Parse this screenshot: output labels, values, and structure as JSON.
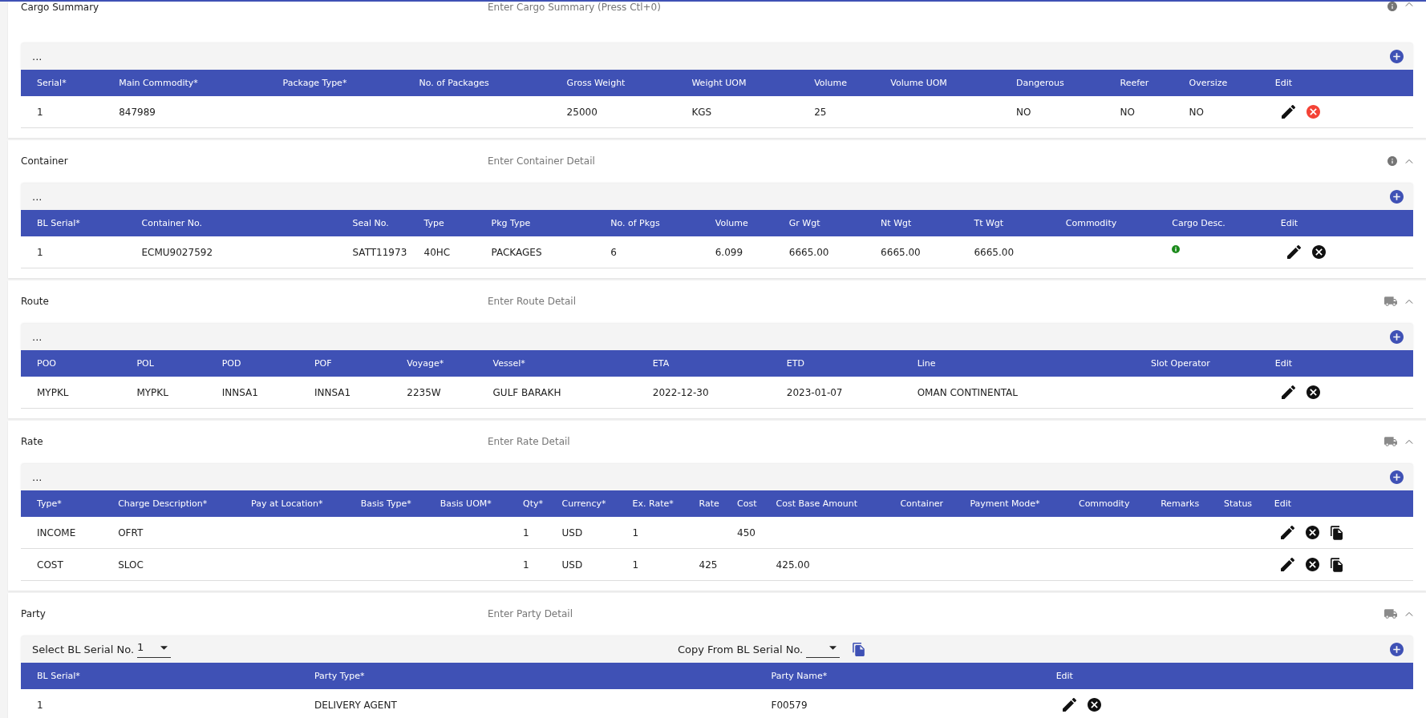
{
  "sections": [
    {
      "title": "Cargo Summary",
      "placeholder": "Enter Cargo Summary (Press Ctl+0)",
      "header_icon": {
        "kind": "info"
      },
      "expanded": true,
      "toolbar": {
        "kind": "menu",
        "text": "..."
      },
      "columns": [
        "Serial*",
        "Main Commodity*",
        "Package Type*",
        "No. of Packages",
        "Gross Weight",
        "Weight UOM",
        "Volume",
        "Volume UOM",
        "Dangerous",
        "Reefer",
        "Oversize",
        "Edit"
      ],
      "rows": [
        {
          "cells": [
            "1",
            "847989",
            null,
            null,
            "25000",
            "KGS",
            "25",
            null,
            "NO",
            "NO",
            "NO"
          ],
          "actions": [
            {
              "kind": "edit"
            },
            {
              "kind": "delete_alert"
            }
          ]
        }
      ]
    },
    {
      "title": "Container",
      "placeholder": "Enter Container Detail",
      "header_icon": {
        "kind": "info"
      },
      "expanded": true,
      "toolbar": {
        "kind": "menu",
        "text": "..."
      },
      "columns": [
        "BL Serial*",
        "Container No.",
        "Seal No.",
        "Type",
        "Pkg Type",
        "No. of Pkgs",
        "Volume",
        "Gr Wgt",
        "Nt Wgt",
        "Tt Wgt",
        "Commodity",
        "Cargo Desc.",
        "Edit"
      ],
      "rows": [
        {
          "cells": [
            "1",
            "ECMU9027592",
            "SATT11973",
            "40HC",
            "PACKAGES",
            "6",
            "6.099",
            "6665.00",
            "6665.00",
            "6665.00",
            null,
            {
              "kind": "marker"
            }
          ],
          "actions": [
            {
              "kind": "edit"
            },
            {
              "kind": "delete"
            }
          ]
        }
      ]
    },
    {
      "title": "Route",
      "placeholder": "Enter Route Detail",
      "header_icon": {
        "kind": "truck"
      },
      "expanded": true,
      "toolbar": {
        "kind": "menu",
        "text": "..."
      },
      "columns": [
        "POO",
        "POL",
        "POD",
        "POF",
        "Voyage*",
        "Vessel*",
        "ETA",
        "ETD",
        "Line",
        "Slot Operator",
        "Edit"
      ],
      "rows": [
        {
          "cells": [
            "MYPKL",
            "MYPKL",
            "INNSA1",
            "INNSA1",
            "2235W",
            "GULF BARAKH",
            "2022-12-30",
            "2023-01-07",
            "OMAN CONTINENTAL",
            null
          ],
          "actions": [
            {
              "kind": "edit"
            },
            {
              "kind": "delete"
            }
          ]
        }
      ]
    },
    {
      "title": "Rate",
      "placeholder": "Enter Rate Detail",
      "header_icon": {
        "kind": "truck"
      },
      "expanded": true,
      "toolbar": {
        "kind": "menu",
        "text": "..."
      },
      "columns": [
        "Type*",
        "Charge Description*",
        "Pay at Location*",
        "Basis Type*",
        "Basis UOM*",
        "Qty*",
        "Currency*",
        "Ex. Rate*",
        "Rate",
        "Cost",
        "Cost Base Amount",
        "Container",
        "Payment Mode*",
        "Commodity",
        "Remarks",
        "Status",
        "Edit"
      ],
      "rows": [
        {
          "cells": [
            "INCOME",
            "OFRT",
            null,
            null,
            null,
            "1",
            "USD",
            "1",
            null,
            "450",
            null,
            null,
            null,
            null,
            null,
            null
          ],
          "actions": [
            {
              "kind": "edit"
            },
            {
              "kind": "delete"
            },
            {
              "kind": "copy"
            }
          ]
        },
        {
          "cells": [
            "COST",
            "SLOC",
            null,
            null,
            null,
            "1",
            "USD",
            "1",
            "425",
            null,
            "425.00",
            null,
            null,
            null,
            null,
            null
          ],
          "actions": [
            {
              "kind": "edit"
            },
            {
              "kind": "delete"
            },
            {
              "kind": "copy"
            }
          ]
        }
      ]
    },
    {
      "title": "Party",
      "placeholder": "Enter Party Detail",
      "header_icon": {
        "kind": "truck"
      },
      "expanded": true,
      "toolbar": {
        "kind": "selectors",
        "serial_label": "Select BL Serial No.",
        "serial_value": "1",
        "copy_label": "Copy From BL Serial No."
      },
      "columns": [
        "BL Serial*",
        "Party Type*",
        "Party Name*",
        "Edit"
      ],
      "rows": [
        {
          "cells": [
            "1",
            "DELIVERY AGENT",
            "F00579"
          ],
          "actions": [
            {
              "kind": "edit"
            },
            {
              "kind": "delete"
            }
          ]
        }
      ]
    }
  ]
}
